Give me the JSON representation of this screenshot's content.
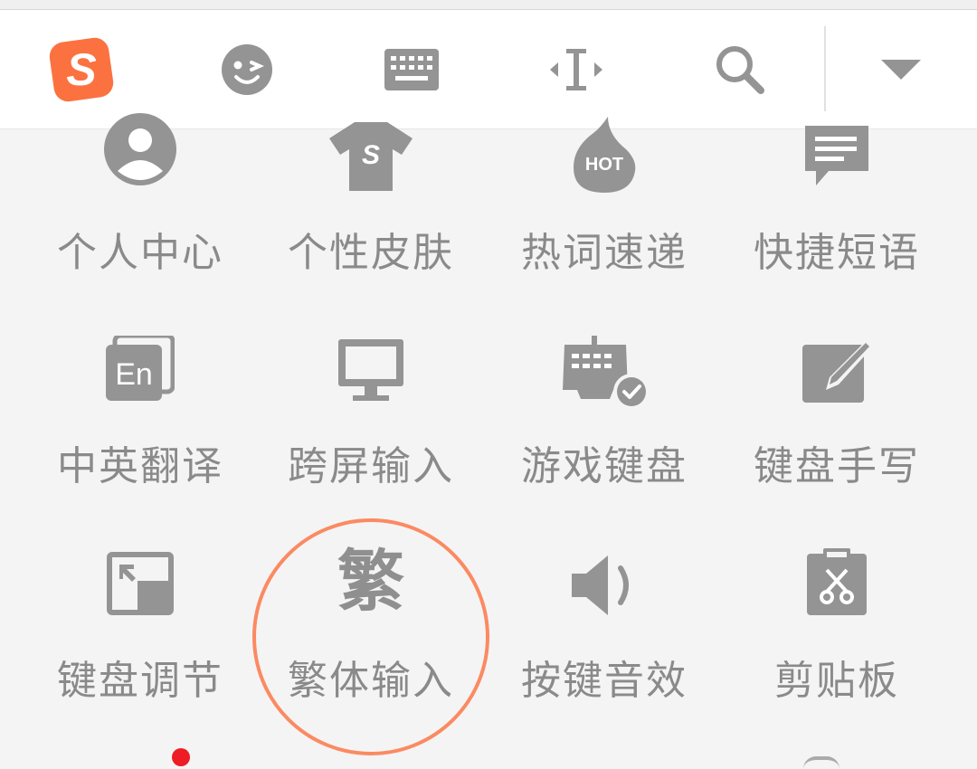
{
  "colors": {
    "brand": "#fb7240",
    "icon": "#949494",
    "label": "#8a8a8a",
    "highlight_ring": "#fb8a62",
    "badge": "#ee1c24"
  },
  "toolbar": {
    "items": [
      {
        "icon": "sogou-logo-icon",
        "glyph": "S"
      },
      {
        "icon": "emoji-icon"
      },
      {
        "icon": "keyboard-icon"
      },
      {
        "icon": "cursor-move-icon"
      },
      {
        "icon": "search-icon"
      },
      {
        "icon": "collapse-dropdown-icon"
      }
    ]
  },
  "menu": {
    "items": [
      {
        "id": "profile",
        "label": "个人中心",
        "icon": "user-icon"
      },
      {
        "id": "skin",
        "label": "个性皮肤",
        "icon": "tshirt-skin-icon"
      },
      {
        "id": "hotwords",
        "label": "热词速递",
        "icon": "hot-drop-icon",
        "icon_text": "HOT"
      },
      {
        "id": "phrases",
        "label": "快捷短语",
        "icon": "message-icon"
      },
      {
        "id": "translate",
        "label": "中英翻译",
        "icon": "translate-en-icon",
        "icon_text": "En"
      },
      {
        "id": "crossscreen",
        "label": "跨屏输入",
        "icon": "monitor-icon"
      },
      {
        "id": "gamekeyboard",
        "label": "游戏键盘",
        "icon": "game-keyboard-icon"
      },
      {
        "id": "handwriting",
        "label": "键盘手写",
        "icon": "pen-write-icon"
      },
      {
        "id": "resize",
        "label": "键盘调节",
        "icon": "resize-icon"
      },
      {
        "id": "traditional",
        "label": "繁体输入",
        "icon": "traditional-char-icon",
        "icon_text": "繁"
      },
      {
        "id": "soundeffect",
        "label": "按键音效",
        "icon": "speaker-icon"
      },
      {
        "id": "clipboard",
        "label": "剪贴板",
        "icon": "clipboard-icon"
      }
    ],
    "highlighted": "繁体输入"
  }
}
